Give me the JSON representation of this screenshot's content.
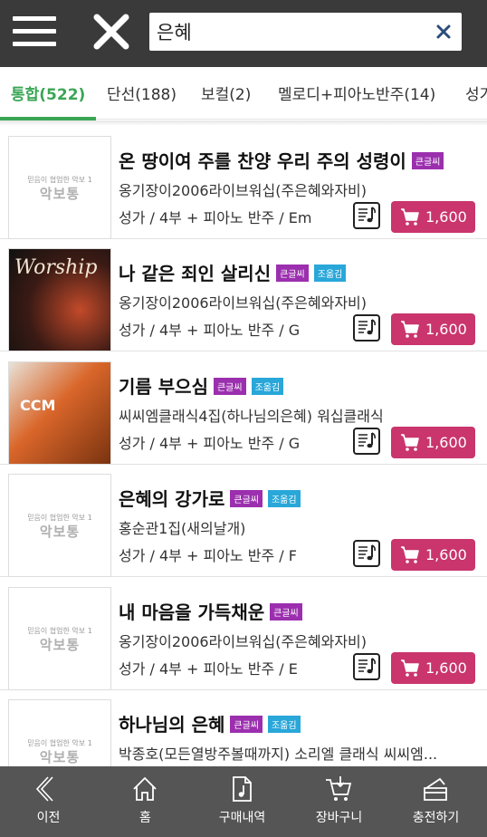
{
  "search": {
    "query": "은혜",
    "placeholder": ""
  },
  "tabs": [
    {
      "label": "통합(522)"
    },
    {
      "label": "단선(188)"
    },
    {
      "label": "보컬(2)"
    },
    {
      "label": "멜로디+피아노반주(14)"
    },
    {
      "label": "성가"
    }
  ],
  "thumb_logo": {
    "top": "믿음이 협업한 악보 1",
    "main": "악보통"
  },
  "items": [
    {
      "title": "온 땅이여 주를 찬양 우리 주의 성령이",
      "badges": [
        "큰글씨"
      ],
      "album": "옹기장이2006라이브워십(주은혜와자비)",
      "meta": "성가 / 4부 + 피아노 반주 / Em",
      "price": "1,600",
      "thumb": "logo"
    },
    {
      "title": "나 같은 죄인 살리신",
      "badges": [
        "큰글씨",
        "조옮김"
      ],
      "album": "옹기장이2006라이브워십(주은혜와자비)",
      "meta": "성가 / 4부 + 피아노 반주 / G",
      "price": "1,600",
      "thumb": "worship",
      "thumb_text": "Worship"
    },
    {
      "title": "기름 부으심",
      "badges": [
        "큰글씨",
        "조옮김"
      ],
      "album": "씨씨엠클래식4집(하나님의은혜) 워십클래식",
      "meta": "성가 / 4부 + 피아노 반주 / G",
      "price": "1,600",
      "thumb": "ccm",
      "thumb_text": "CCM"
    },
    {
      "title": "은혜의 강가로",
      "badges": [
        "큰글씨",
        "조옮김"
      ],
      "album": "홍순관1집(새의날개)",
      "meta": "성가 / 4부 + 피아노 반주 / F",
      "price": "1,600",
      "thumb": "logo"
    },
    {
      "title": "내 마음을 가득채운",
      "badges": [
        "큰글씨"
      ],
      "album": "옹기장이2006라이브워십(주은혜와자비)",
      "meta": "성가 / 4부 + 피아노 반주 / E",
      "price": "1,600",
      "thumb": "logo"
    },
    {
      "title": "하나님의 은혜",
      "badges": [
        "큰글씨",
        "조옮김"
      ],
      "album": "박종호(모든열방주볼때까지) 소리엘 클래식 씨씨엠...",
      "meta": "",
      "price": "",
      "thumb": "logo"
    }
  ],
  "bottom_nav": [
    {
      "label": "이전",
      "icon": "chevron-left-icon"
    },
    {
      "label": "홈",
      "icon": "home-icon"
    },
    {
      "label": "구매내역",
      "icon": "document-music-icon"
    },
    {
      "label": "장바구니",
      "icon": "cart-icon"
    },
    {
      "label": "충전하기",
      "icon": "wallet-icon"
    }
  ],
  "colors": {
    "topbar": "#3a3a3a",
    "active_tab": "#3aa655",
    "buy": "#c9356c",
    "badge_purple": "#9b2fae",
    "badge_cyan": "#29a7d9",
    "bottom_nav": "#555555"
  }
}
